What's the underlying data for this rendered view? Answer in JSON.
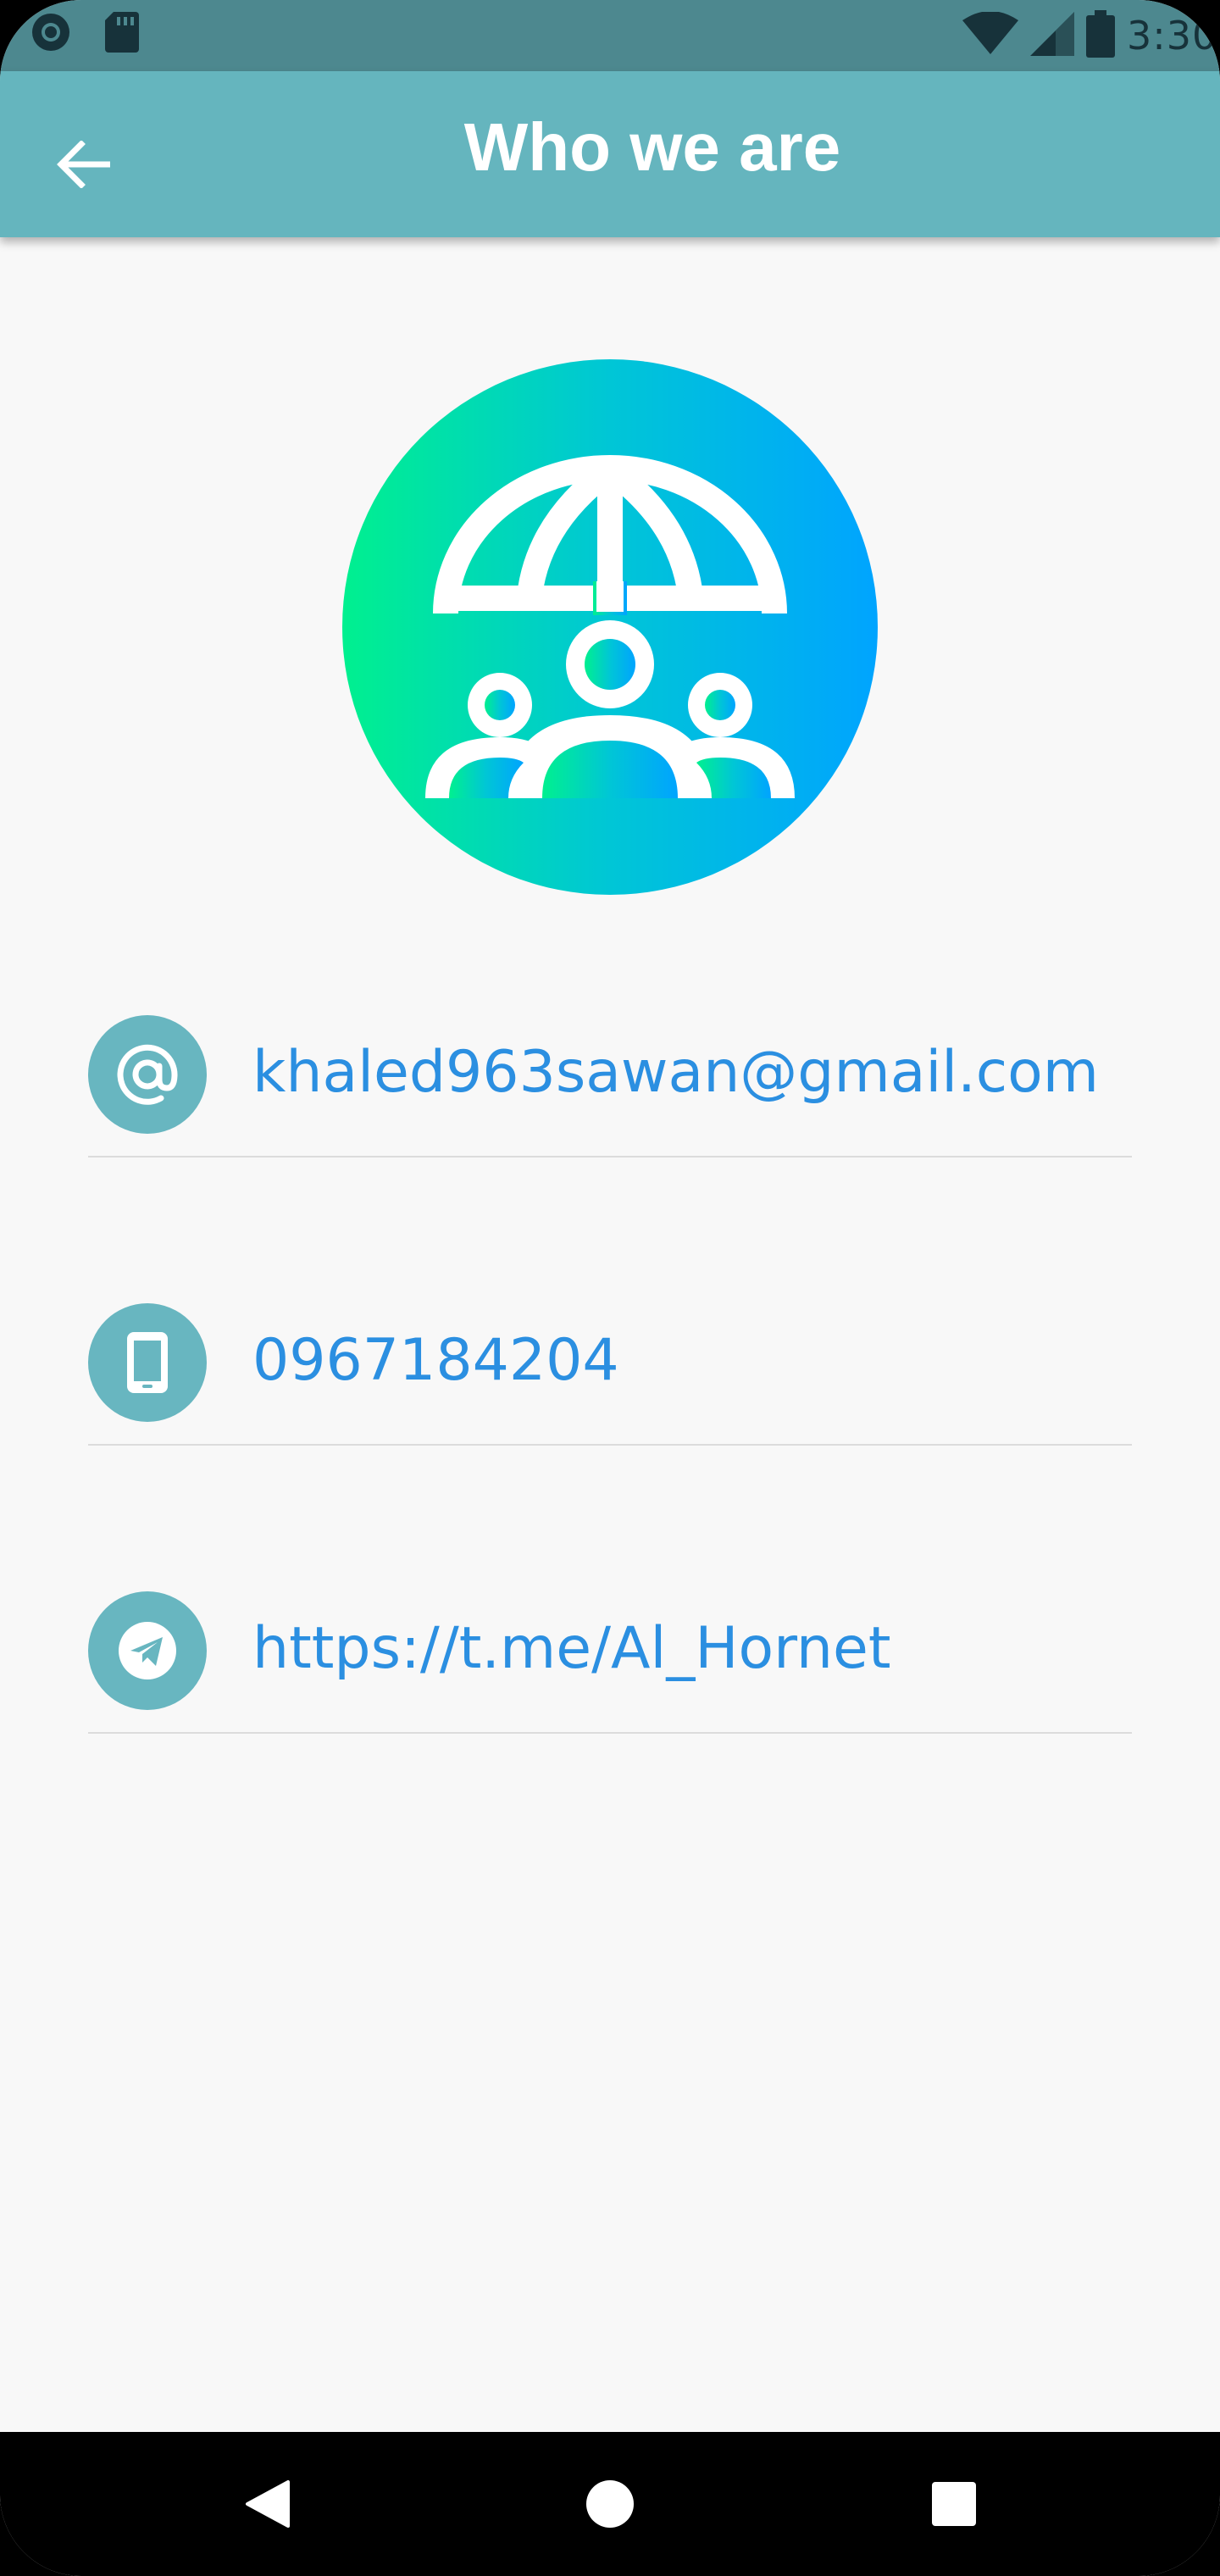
{
  "status_bar": {
    "time": "3:30"
  },
  "app_bar": {
    "title": "Who we are"
  },
  "contacts": [
    {
      "icon": "at-sign-icon",
      "value": "khaled963sawan@gmail.com"
    },
    {
      "icon": "phone-icon",
      "value": "0967184204"
    },
    {
      "icon": "telegram-icon",
      "value": "https://t.me/Al_Hornet"
    }
  ],
  "colors": {
    "status_bar": "#4d888f",
    "app_bar": "#65b5be",
    "icon_circle": "#68b6c0",
    "link_text": "#2b8fe1",
    "logo_gradient_start": "#00f08f",
    "logo_gradient_end": "#00a4ff"
  }
}
